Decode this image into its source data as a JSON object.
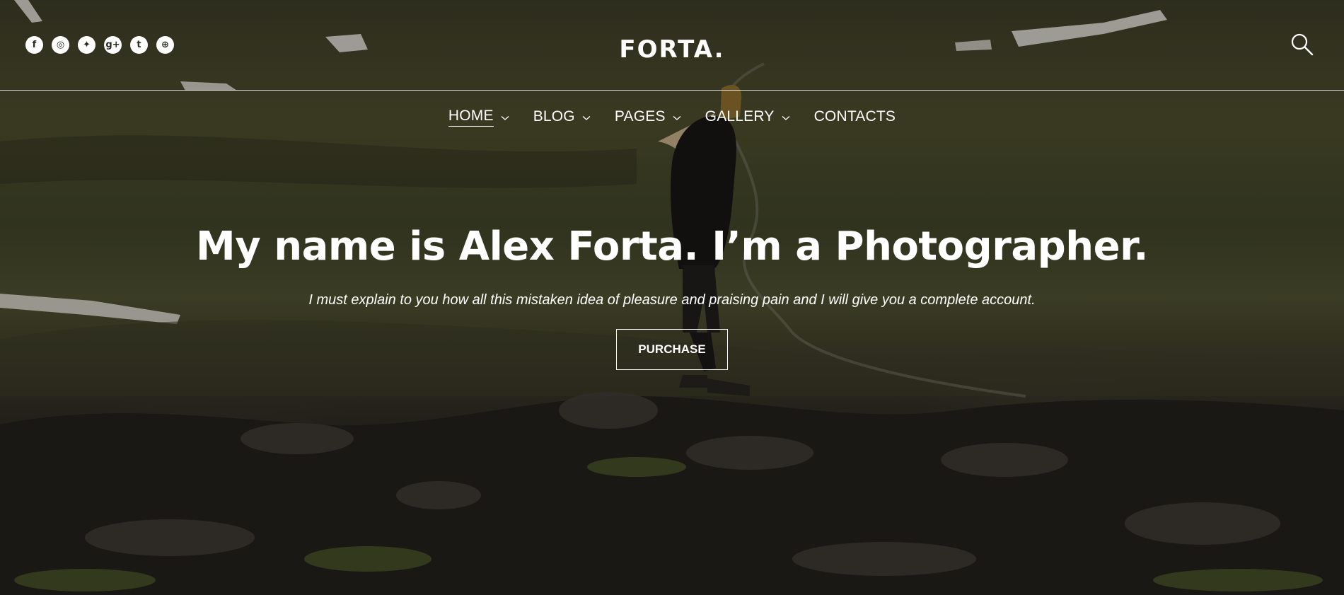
{
  "social": [
    {
      "icon": "facebook-icon",
      "glyph": "f"
    },
    {
      "icon": "instagram-icon",
      "glyph": "◎"
    },
    {
      "icon": "twitter-icon",
      "glyph": "✦"
    },
    {
      "icon": "google-plus-icon",
      "glyph": "g+"
    },
    {
      "icon": "tumblr-icon",
      "glyph": "t"
    },
    {
      "icon": "dribbble-icon",
      "glyph": "⊕"
    }
  ],
  "header": {
    "logo": "FORTA."
  },
  "nav": [
    {
      "label": "HOME",
      "dropdown": true,
      "active": true
    },
    {
      "label": "BLOG",
      "dropdown": true,
      "active": false
    },
    {
      "label": "PAGES",
      "dropdown": true,
      "active": false
    },
    {
      "label": "GALLERY",
      "dropdown": true,
      "active": false
    },
    {
      "label": "CONTACTS",
      "dropdown": false,
      "active": false
    }
  ],
  "hero": {
    "headline": "My name is Alex Forta. I’m a Photographer.",
    "subtitle": "I must explain to you how all this mistaken idea of pleasure and praising pain and I will give you a complete account.",
    "button": "PURCHASE"
  },
  "colors": {
    "overlay_text": "#ffffff",
    "background_dark": "#2a2720"
  }
}
